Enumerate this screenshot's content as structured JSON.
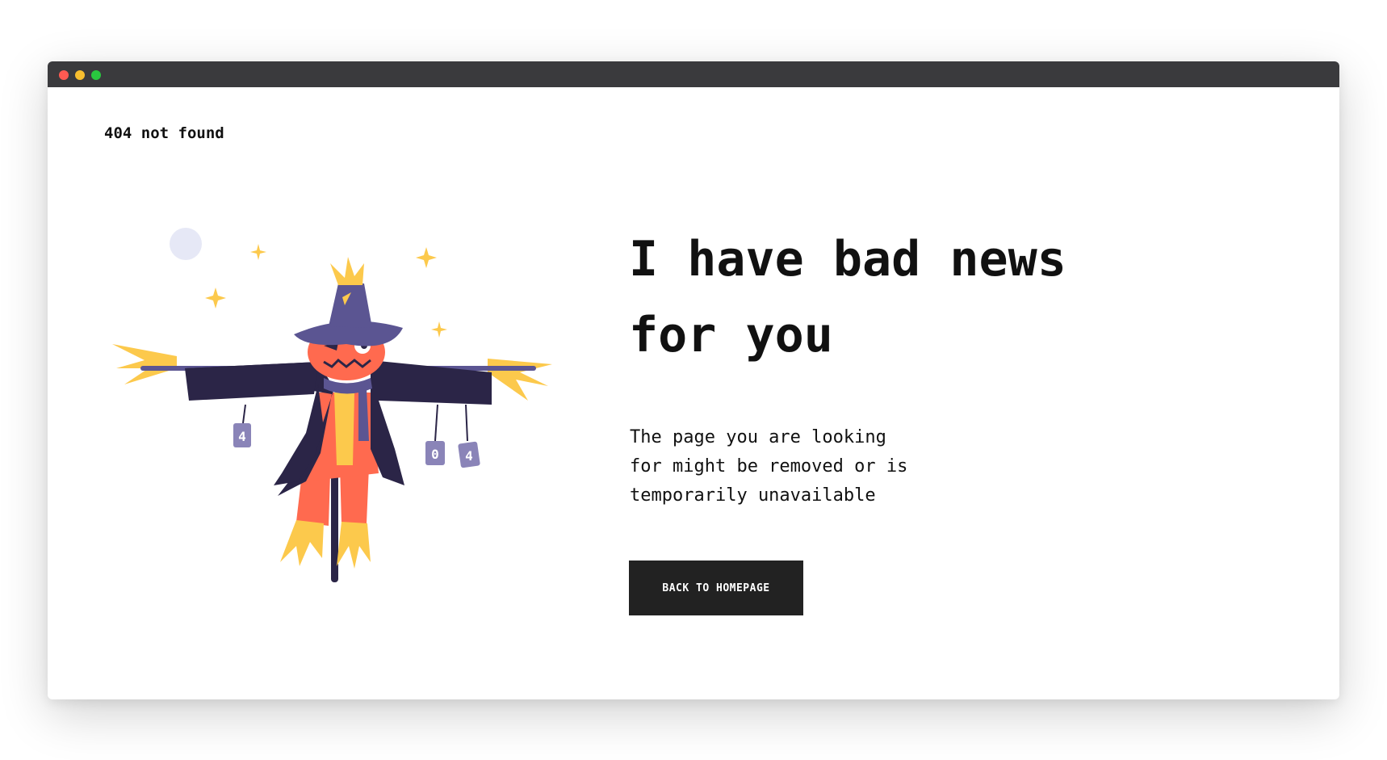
{
  "window": {
    "controls": [
      "close",
      "minimize",
      "maximize"
    ]
  },
  "brand": {
    "label": "404 not found"
  },
  "illustration": {
    "icon": "scarecrow-illustration",
    "cans": [
      "4",
      "0",
      "4"
    ]
  },
  "main": {
    "headline_line1": "I have bad news",
    "headline_line2": "for you",
    "description_line1": "The page you are looking",
    "description_line2": "for might be removed or is",
    "description_line3": "temporarily unavailable",
    "cta_label": "BACK TO HOMEPAGE"
  },
  "colors": {
    "titlebar": "#3a3a3d",
    "close": "#ff5a52",
    "minimize": "#f7be2f",
    "maximize": "#29c83f",
    "button_bg": "#222222",
    "hat": "#5b5592",
    "pumpkin": "#ff6a4f",
    "coat": "#2b2547",
    "straw": "#fcc94c"
  }
}
